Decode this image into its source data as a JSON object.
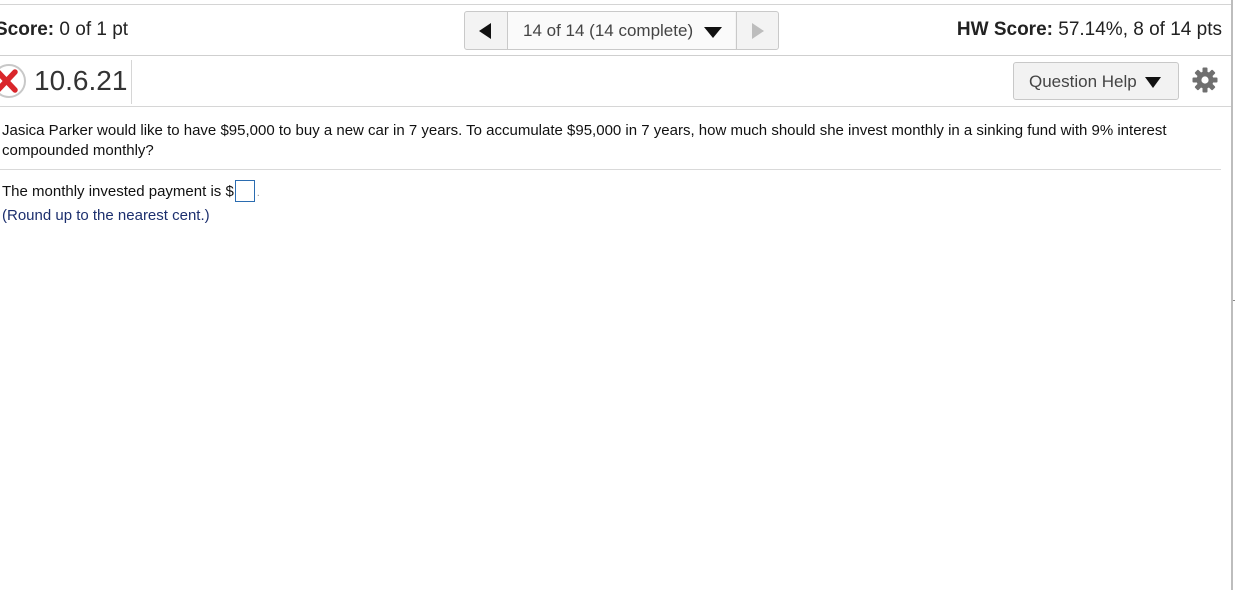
{
  "score_bar": {
    "score_label": "Score:",
    "score_value": "0 of 1 pt",
    "nav": {
      "position_label": "14 of 14 (14 complete)"
    },
    "hw_score_label": "HW Score:",
    "hw_score_value": "57.14%, 8 of 14 pts"
  },
  "question": {
    "number": "10.6.21",
    "status_icon": "incorrect-x-icon",
    "help_button_label": "Question Help",
    "settings_icon": "gear-icon",
    "text": "Jasica Parker would like to have $95,000 to buy a new car in 7 years. To accumulate $95,000 in 7 years, how much should she invest monthly in a sinking fund with 9% interest compounded monthly?",
    "answer_prefix": "The monthly invested payment is $",
    "answer_value": "",
    "answer_suffix": ".",
    "hint": "(Round up to the nearest cent.)"
  },
  "colors": {
    "incorrect_red": "#d9262b",
    "hint_text": "#1c2f6e",
    "input_border": "#2b6cb0"
  }
}
